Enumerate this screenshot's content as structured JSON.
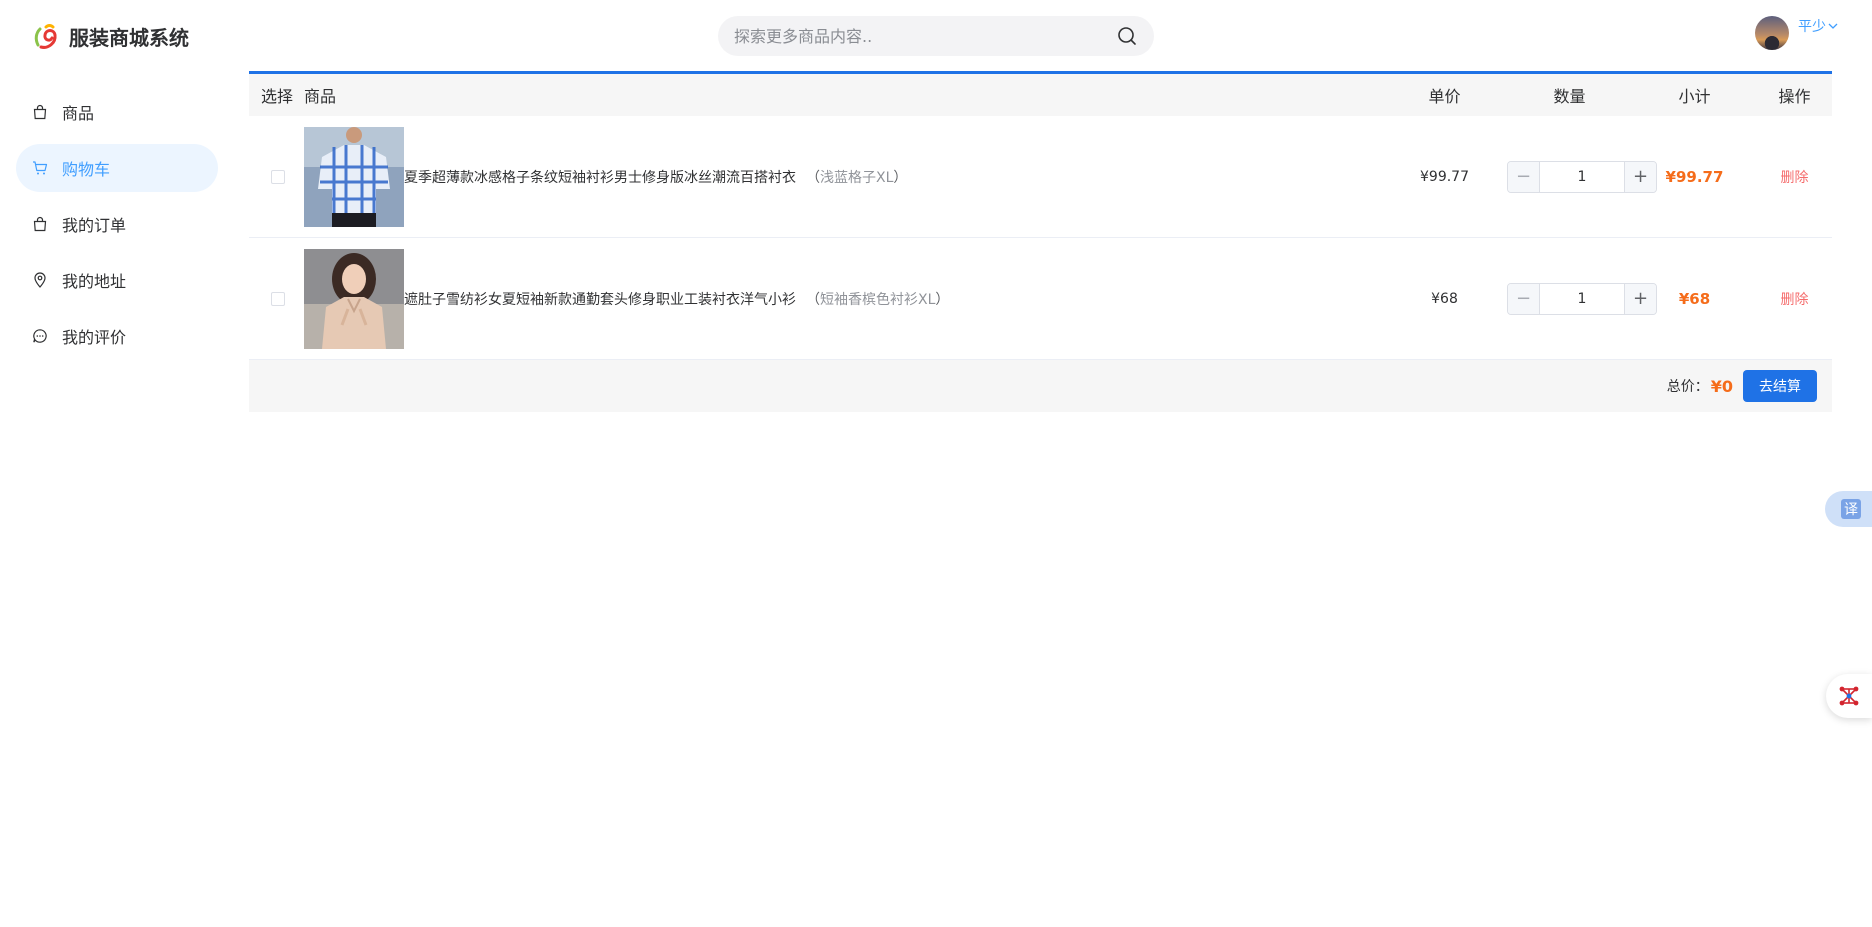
{
  "app": {
    "title": "服装商城系统"
  },
  "search": {
    "placeholder": "探索更多商品内容.."
  },
  "user": {
    "name": "平少"
  },
  "sidebar": {
    "items": [
      {
        "label": "商品",
        "icon": "shopping-bag-icon",
        "active": false
      },
      {
        "label": "购物车",
        "icon": "cart-icon",
        "active": true
      },
      {
        "label": "我的订单",
        "icon": "shopping-bag-icon",
        "active": false
      },
      {
        "label": "我的地址",
        "icon": "location-pin-icon",
        "active": false
      },
      {
        "label": "我的评价",
        "icon": "chat-bubble-icon",
        "active": false
      }
    ]
  },
  "cart": {
    "headers": {
      "select": "选择",
      "product": "商品",
      "price": "单价",
      "quantity": "数量",
      "subtotal": "小计",
      "action": "操作"
    },
    "items": [
      {
        "name": "夏季超薄款冰感格子条纹短袖衬衫男士修身版冰丝潮流百搭衬衣",
        "variant": "浅蓝格子XL",
        "price": "¥99.77",
        "quantity": "1",
        "subtotal": "¥99.77",
        "delete_label": "删除"
      },
      {
        "name": "遮肚子雪纺衫女夏短袖新款通勤套头修身职业工装衬衣洋气小衫",
        "variant": "短袖香槟色衬衫XL",
        "price": "¥68",
        "quantity": "1",
        "subtotal": "¥68",
        "delete_label": "删除"
      }
    ],
    "total_label": "总价：",
    "total_value": "¥0",
    "checkout_label": "去结算"
  },
  "widgets": {
    "translate_label": "译"
  },
  "colors": {
    "accent": "#409eff",
    "primary_button": "#1f72e6",
    "price_highlight": "#f56c1a",
    "danger": "#f56c6c"
  }
}
